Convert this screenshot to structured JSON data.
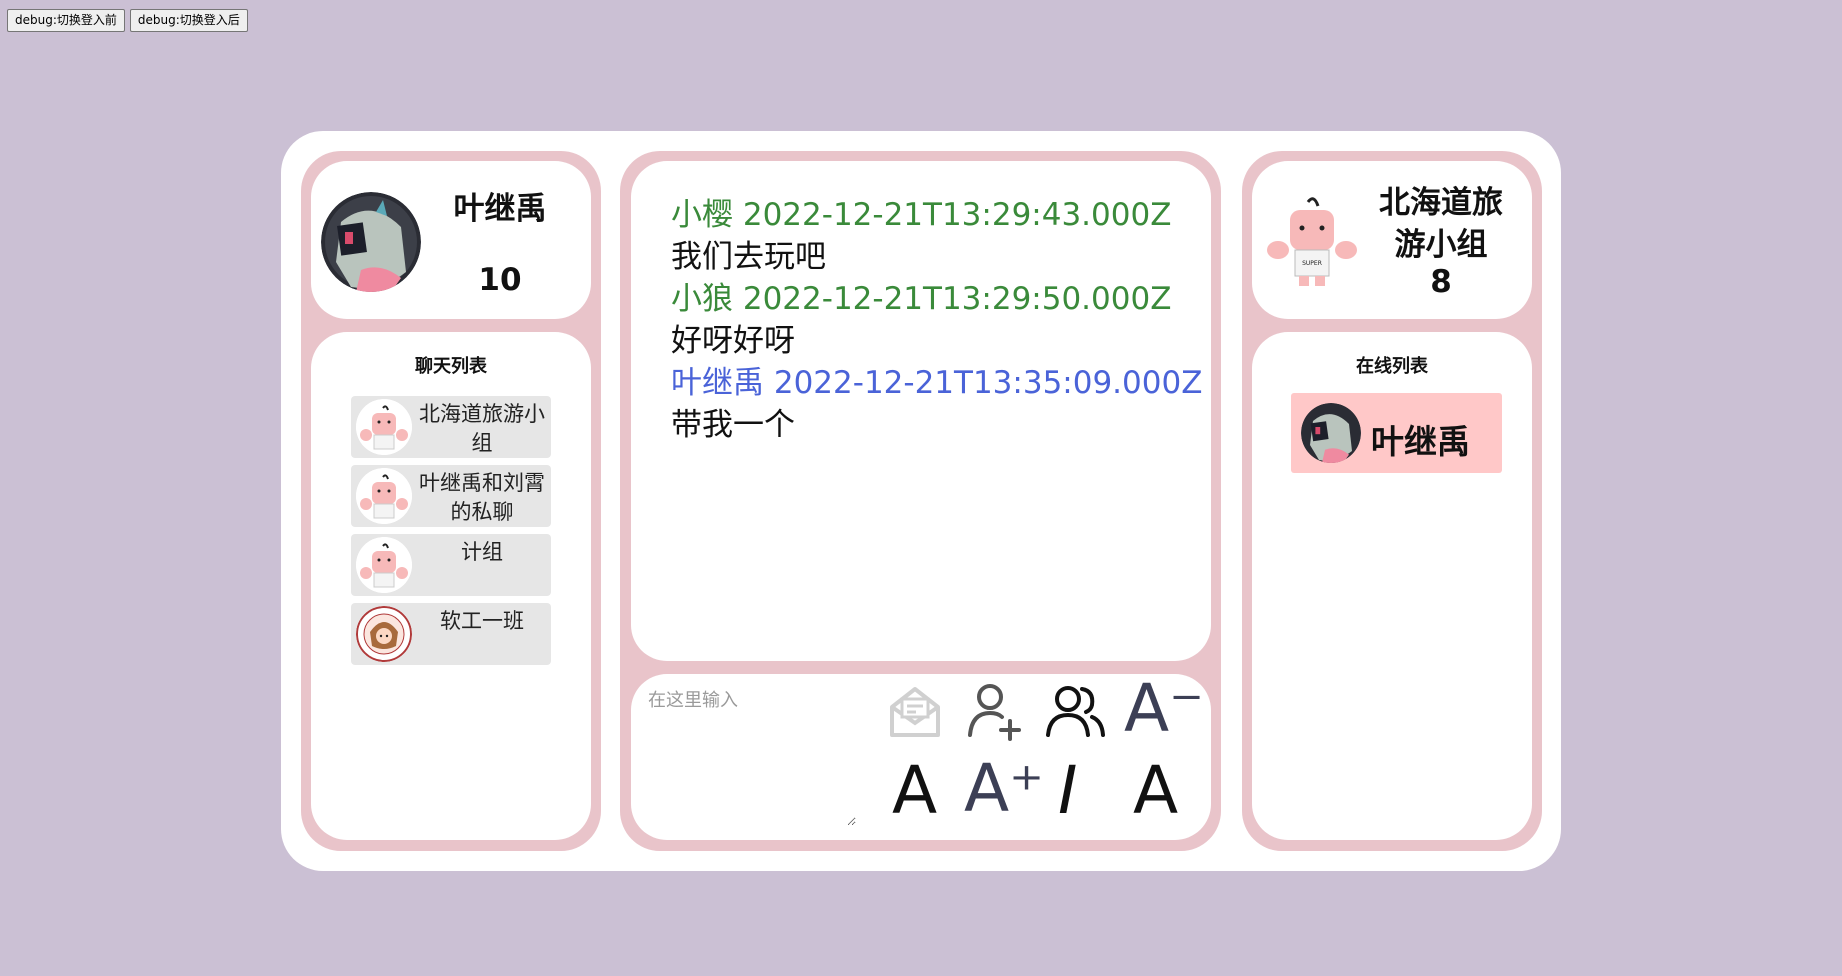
{
  "debug": {
    "before_label": "debug:切换登入前",
    "after_label": "debug:切换登入后"
  },
  "profile": {
    "name": "叶继禹",
    "count": "10"
  },
  "chat_list": {
    "title": "聊天列表",
    "items": [
      {
        "label": "北海道旅游小组",
        "icon": "cartoon-avatar"
      },
      {
        "label": "叶继禹和刘霄的私聊",
        "icon": "cartoon-avatar"
      },
      {
        "label": "计组",
        "icon": "cartoon-avatar"
      },
      {
        "label": "软工一班",
        "icon": "badge-avatar"
      }
    ]
  },
  "messages": [
    {
      "sender": "小樱",
      "time": "2022-12-21T13:29:43.000Z",
      "text": "我们去玩吧",
      "color": "#3a8a3a"
    },
    {
      "sender": "小狼",
      "time": "2022-12-21T13:29:50.000Z",
      "text": "好呀好呀",
      "color": "#3a8a3a"
    },
    {
      "sender": "叶继禹",
      "time": "2022-12-21T13:35:09.000Z",
      "text": "带我一个",
      "color": "#4a63d8"
    }
  ],
  "input": {
    "placeholder": "在这里输入"
  },
  "toolbar": {
    "send_icon": "envelope-icon",
    "add_user_icon": "add-user-icon",
    "users_icon": "users-icon",
    "font_decrease": "A⁻",
    "font_normal": "A",
    "font_increase": "A⁺",
    "italic": "I",
    "font_reset": "A"
  },
  "group": {
    "name": "北海道旅游小组",
    "count": "8"
  },
  "online_list": {
    "title": "在线列表",
    "users": [
      {
        "name": "叶继禹"
      }
    ]
  },
  "colors": {
    "background": "#cbc0d4",
    "panel": "#e9c4ca",
    "chat_item_bg": "#e6e6e6",
    "online_item_bg": "#ffc8c8",
    "other_sender": "#3a8a3a",
    "self_sender": "#4a63d8"
  }
}
